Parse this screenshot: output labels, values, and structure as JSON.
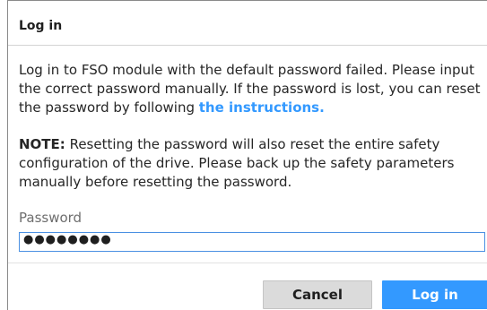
{
  "dialog": {
    "title": "Log in",
    "message": {
      "text": "Log in to FSO module with the default password failed. Please input the correct password manually. If the password is lost, you can reset the password by following ",
      "link_text": "the instructions."
    },
    "note": {
      "label": "NOTE:",
      "text": " Resetting the password will also reset the entire safety configuration of the drive. Please back up the safety parameters manually before resetting the password."
    },
    "password": {
      "label": "Password",
      "value": "●●●●●●●●"
    },
    "buttons": {
      "cancel": "Cancel",
      "login": "Log in"
    }
  },
  "colors": {
    "accent": "#3399ff",
    "secondary_button": "#dbdbdb"
  }
}
